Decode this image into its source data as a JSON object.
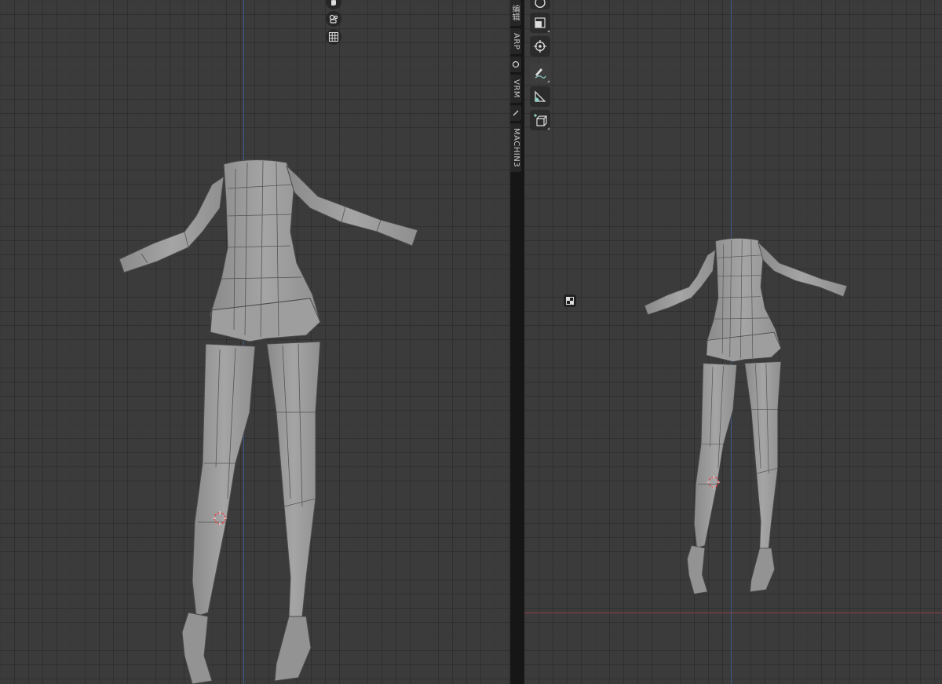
{
  "viewports": [
    {
      "name": "left-viewport"
    },
    {
      "name": "right-viewport"
    }
  ],
  "colors": {
    "grid_bg": "#3b3b3b",
    "axis_y_blue": "#3f64a6",
    "axis_x_red": "#a8414a",
    "mesh_fill": "#9b9b9b",
    "mesh_edge": "#4a4a4a",
    "cursor_red": "#e0444a"
  },
  "n_panel_tabs": [
    {
      "label": "编辑",
      "type": "text"
    },
    {
      "label": "ARP",
      "type": "text"
    },
    {
      "icon": "circle-icon",
      "type": "icon"
    },
    {
      "label": "VRM",
      "type": "text"
    },
    {
      "icon": "pen-icon",
      "type": "icon"
    },
    {
      "label": "MACHIN3",
      "type": "text"
    }
  ],
  "toolbar": [
    {
      "icon": "rotate-icon"
    },
    {
      "icon": "scale-icon"
    },
    {
      "icon": "transform-icon"
    },
    {
      "icon": "annotate-icon"
    },
    {
      "icon": "measure-icon"
    },
    {
      "icon": "add-cube-icon"
    }
  ],
  "gizmo_buttons": [
    {
      "icon": "hand-pan-icon"
    },
    {
      "icon": "camera-icon"
    },
    {
      "icon": "grid-view-icon"
    }
  ]
}
